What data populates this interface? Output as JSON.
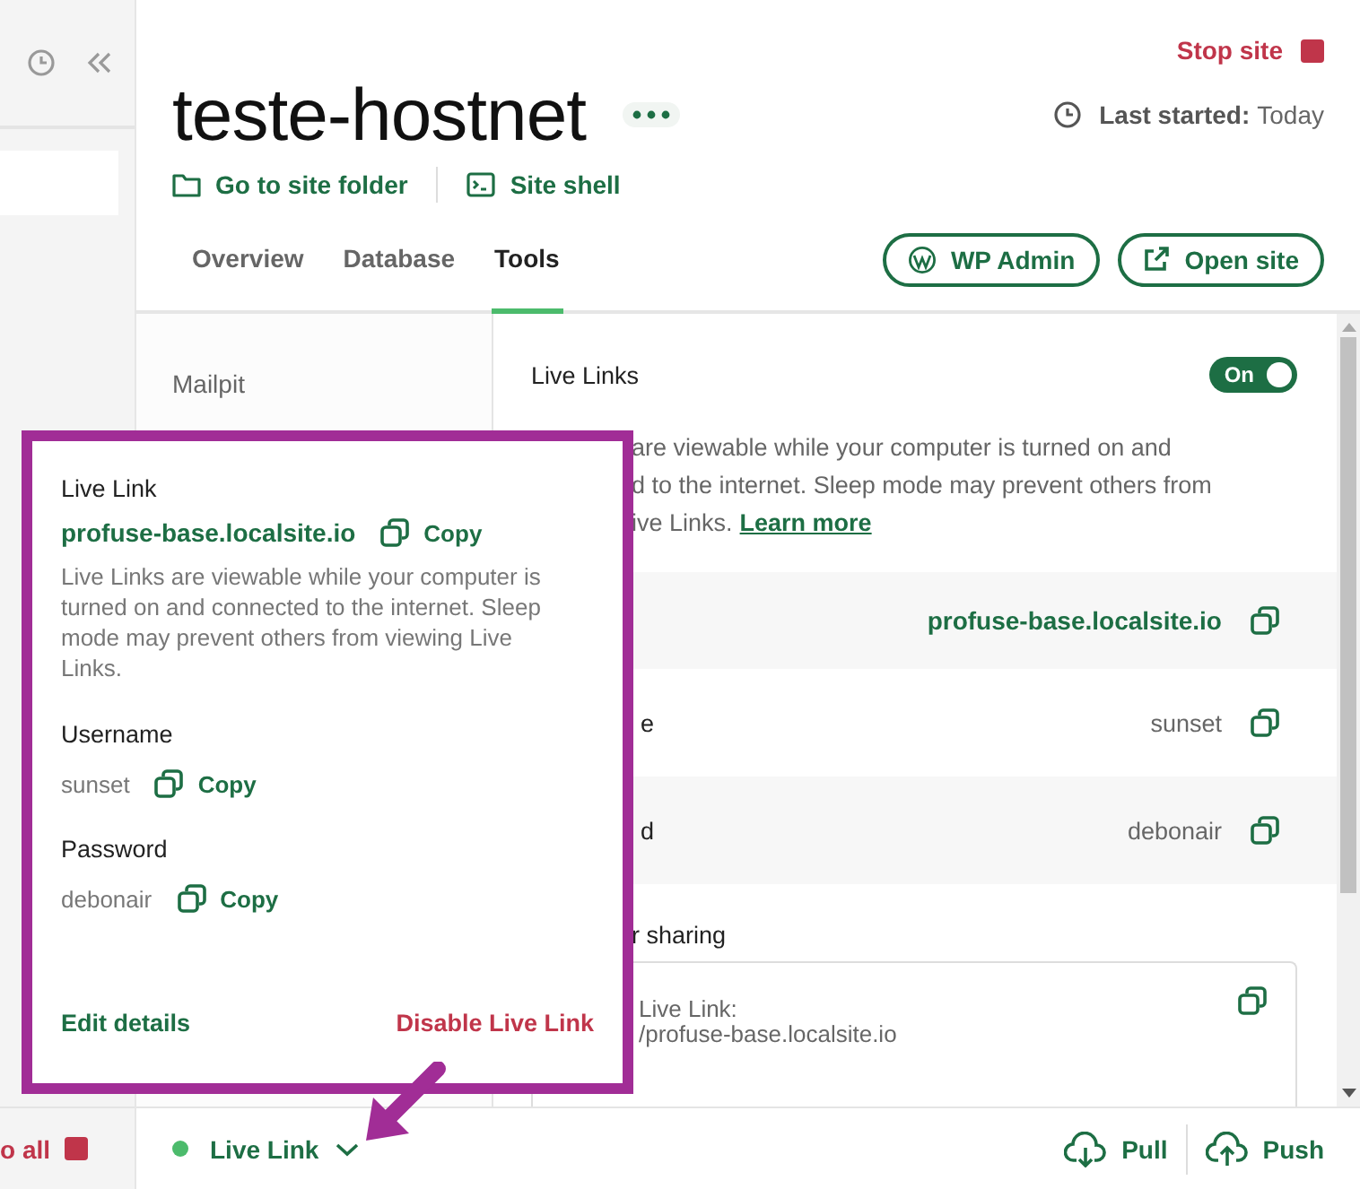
{
  "sidebar": {
    "footer_action": "o all"
  },
  "site": {
    "title": "teste-hostnet",
    "stop_label": "Stop site",
    "last_started_label": "Last started:",
    "last_started_value": "Today",
    "links": [
      {
        "label": "Go to site folder"
      },
      {
        "label": "Site shell"
      }
    ]
  },
  "tabs": [
    {
      "label": "Overview",
      "selected": false
    },
    {
      "label": "Database",
      "selected": false
    },
    {
      "label": "Tools",
      "selected": true
    }
  ],
  "header_buttons": [
    {
      "label": "WP Admin"
    },
    {
      "label": "Open site"
    }
  ],
  "tools_menu": [
    "Mailpit"
  ],
  "live_links": {
    "title": "Live Links",
    "toggle": {
      "label": "On",
      "on": true
    },
    "description_lines": [
      "are viewable while your computer is turned on and",
      "d to the internet. Sleep mode may prevent others from",
      "ive Links."
    ],
    "learn_more": "Learn more",
    "rows": [
      {
        "kind": "link",
        "value": "profuse-base.localsite.io"
      },
      {
        "kind": "text",
        "label": "e",
        "value": "sunset"
      },
      {
        "kind": "text",
        "label": "d",
        "value": "debonair"
      }
    ],
    "sharing_heading": "r sharing",
    "share_box_lines": [
      "Live Link:",
      "/profuse-base.localsite.io"
    ]
  },
  "popup": {
    "title": "Live Link",
    "url": "profuse-base.localsite.io",
    "url_copy": "Copy",
    "description": "Live Links are viewable while your computer is turned on and connected to the internet. Sleep mode may prevent others from viewing Live Links.",
    "fields": [
      {
        "label": "Username",
        "value": "sunset",
        "copy": "Copy"
      },
      {
        "label": "Password",
        "value": "debonair",
        "copy": "Copy"
      }
    ],
    "edit": "Edit details",
    "disable": "Disable Live Link"
  },
  "footer": {
    "status": {
      "label": "Live Link",
      "online": true
    },
    "actions": [
      {
        "label": "Pull"
      },
      {
        "label": "Push"
      }
    ]
  }
}
